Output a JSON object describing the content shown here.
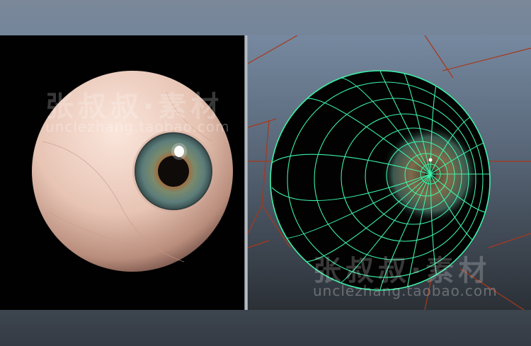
{
  "render_view": {
    "watermark_text": "张叔叔·素材",
    "watermark_url": "unclezhang.taobao.com"
  },
  "wireframe_view": {
    "watermark_text": "张叔叔·素材",
    "watermark_url": "unclezhang.taobao.com"
  },
  "colors": {
    "wire": "#3cf2a8",
    "grid": "#b33a1c",
    "sclera": "#f2d6c8",
    "iris": "#5f7f78"
  }
}
